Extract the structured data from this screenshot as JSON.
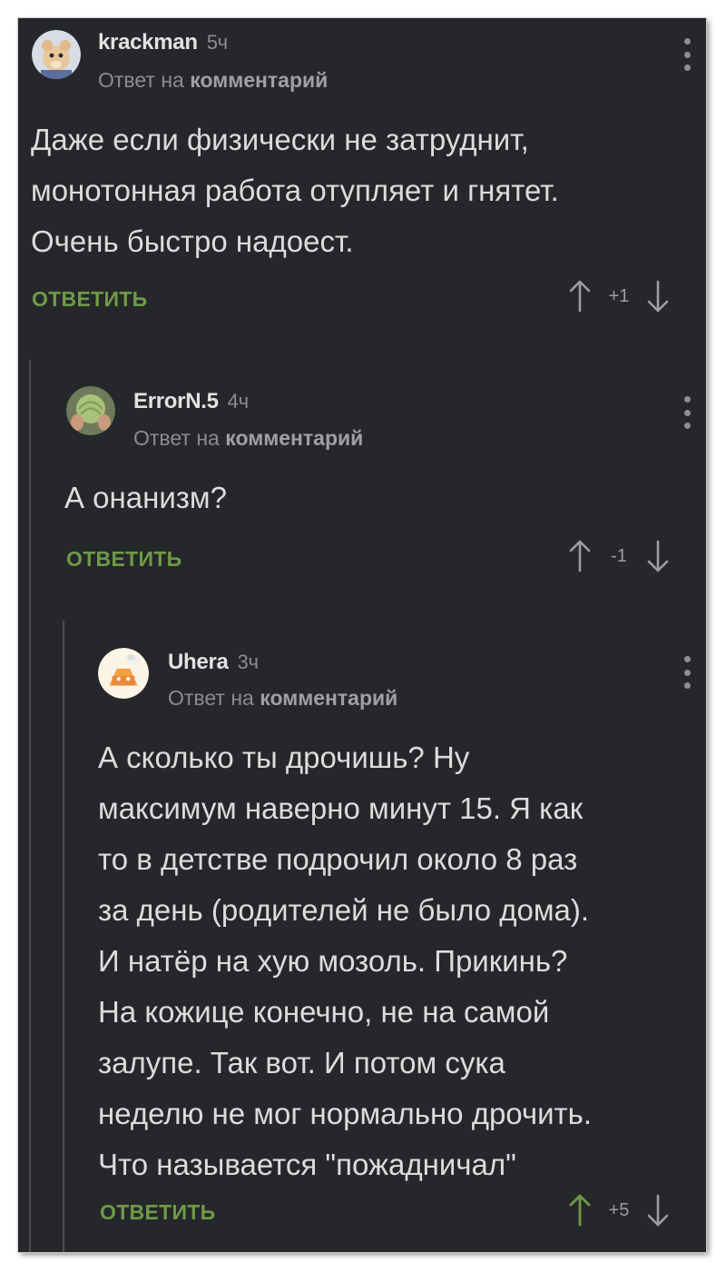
{
  "colors": {
    "background": "#25272b",
    "reply_button": "#6f9a46",
    "upvoted_arrow": "#6f9a46",
    "muted_text": "#8a8c90",
    "body_text": "#dcdcdc"
  },
  "comments": [
    {
      "username": "krackman",
      "time": "5ч",
      "reply_prefix": "Ответ на",
      "reply_target": "комментарий",
      "text": "Даже если физически не затруднит,\nмонотонная работа отупляет и гнятет.\nОчень быстро надоест.",
      "reply_label": "ОТВЕТИТЬ",
      "score": "+1",
      "avatar_icon": "hamster-avatar",
      "upvoted": false
    },
    {
      "username": "ErrorN.5",
      "time": "4ч",
      "reply_prefix": "Ответ на",
      "reply_target": "комментарий",
      "text": "А онанизм?",
      "reply_label": "ОТВЕТИТЬ",
      "score": "-1",
      "avatar_icon": "cabbage-avatar",
      "upvoted": false
    },
    {
      "username": "Uhera",
      "time": "3ч",
      "reply_prefix": "Ответ на",
      "reply_target": "комментарий",
      "text": "А сколько ты дрочишь? Ну\nмаксимум наверно минут 15. Я как\nто в детстве подрочил около 8 раз\nза день (родителей не было дома).\nИ натёр на хую мозоль. Прикинь?\nНа кожице конечно, не на самой\nзалупе. Так вот. И потом сука\nнеделю не мог нормально дрочить.\nЧто называется \"пожадничал\"",
      "reply_label": "ОТВЕТИТЬ",
      "score": "+5",
      "avatar_icon": "cartoon-chef-avatar",
      "upvoted": true
    }
  ]
}
